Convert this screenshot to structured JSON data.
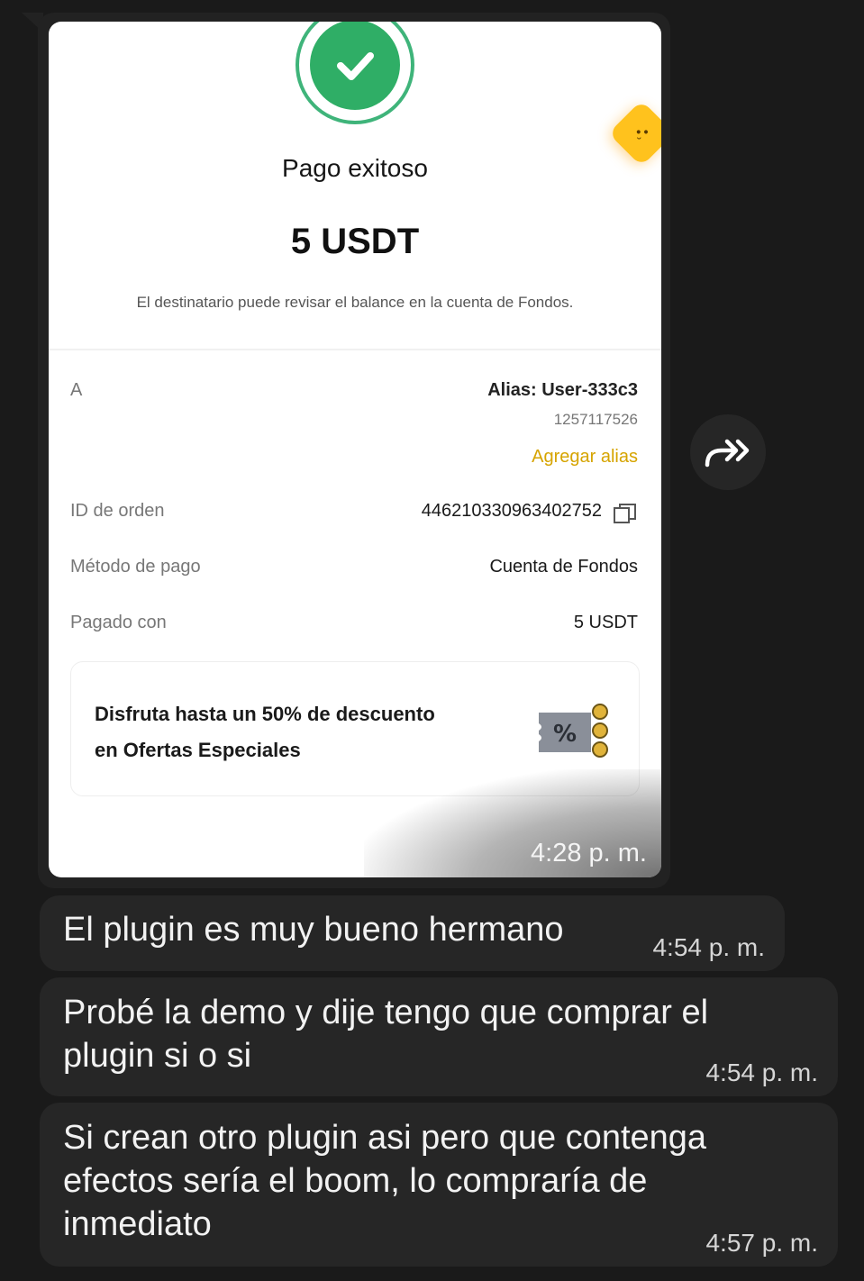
{
  "receipt": {
    "title": "Pago exitoso",
    "amount": "5 USDT",
    "note": "El destinatario puede revisar el balance en la cuenta de Fondos.",
    "to_label": "A",
    "alias": "Alias: User-333c3",
    "alias_number": "1257117526",
    "add_alias": "Agregar alias",
    "order_label": "ID de orden",
    "order_value": "446210330963402752",
    "method_label": "Método de pago",
    "method_value": "Cuenta de Fondos",
    "paid_label": "Pagado con",
    "paid_value": "5 USDT",
    "promo_line1": "Disfruta hasta un 50% de descuento",
    "promo_line2": "en Ofertas Especiales",
    "icons": [
      "check-icon",
      "mascot-icon",
      "copy-icon",
      "discount-ticket-icon"
    ],
    "colors": {
      "success": "#2fae66",
      "accent": "#d6a400",
      "mascot": "#ffc21d"
    }
  },
  "image_message": {
    "time": "4:28 p. m."
  },
  "forward": {
    "icon": "forward-icon"
  },
  "messages": [
    {
      "lines": [
        "El plugin es muy bueno hermano"
      ],
      "time": "4:54 p. m."
    },
    {
      "lines": [
        "Probé la demo y dije tengo que comprar el",
        "plugin si o si"
      ],
      "time": "4:54 p. m."
    },
    {
      "lines": [
        "Si crean otro plugin asi pero que contenga",
        "efectos sería el boom, lo compraría de",
        "inmediato"
      ],
      "time": "4:57 p. m."
    }
  ],
  "theme": {
    "background": "#1a1a1a",
    "bubble": "#262626",
    "text": "#f2f2f2"
  }
}
